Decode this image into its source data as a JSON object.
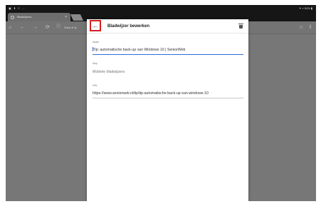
{
  "status_bar": {
    "left_icons": "▣ ⬇ ≡ …",
    "right_text": "✶ ▿ 54% ▮"
  },
  "browser": {
    "tab_title": "Bladwijzers",
    "tab_close": "×",
    "omnibox_text": "Zoek of ty",
    "icons": {
      "home": "⌂",
      "back": "←",
      "forward": "→",
      "reload": "⟳",
      "info": "ⓘ",
      "star": "☆",
      "download": "⇩"
    }
  },
  "dialog": {
    "back_icon": "←",
    "title": "Bladwijzer bewerken",
    "name_label": "Naam",
    "name_value": "Tip: automatische back-up van Windows 10 | SeniorWeb",
    "folder_label": "Map",
    "folder_value": "Mobiele bladwijzers",
    "url_label": "URL",
    "url_value": "https://www.seniorweb.nl/tip/tip-automatische-back-up-van-windows-10"
  },
  "colors": {
    "highlight": "#d42020",
    "focus_underline": "#2f6fdc",
    "backdrop": "#777777"
  }
}
